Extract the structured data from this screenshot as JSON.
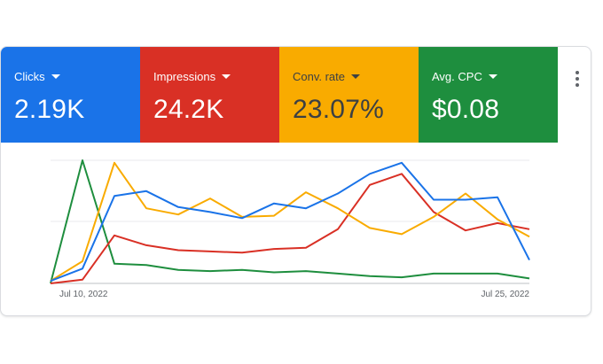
{
  "metrics": [
    {
      "label": "Clicks",
      "value": "2.19K",
      "color": "#1a73e8"
    },
    {
      "label": "Impressions",
      "value": "24.2K",
      "color": "#d93025"
    },
    {
      "label": "Conv. rate",
      "value": "23.07%",
      "color": "#f9ab00"
    },
    {
      "label": "Avg. CPC",
      "value": "$0.08",
      "color": "#1e8e3e"
    }
  ],
  "more_icon": "more-vert-icon",
  "chart_data": {
    "type": "line",
    "x_tick_labels": [
      "Jul 10, 2022",
      "Jul 25, 2022"
    ],
    "x": [
      "Jul 10",
      "Jul 11",
      "Jul 12",
      "Jul 13",
      "Jul 14",
      "Jul 15",
      "Jul 16",
      "Jul 17",
      "Jul 18",
      "Jul 19",
      "Jul 20",
      "Jul 21",
      "Jul 22",
      "Jul 23",
      "Jul 24",
      "Jul 25"
    ],
    "grid": true,
    "ylim": [
      0,
      100
    ],
    "series": [
      {
        "metric": "Clicks",
        "color": "#1a73e8",
        "values": [
          2,
          12,
          71,
          75,
          62,
          58,
          53,
          65,
          61,
          73,
          89,
          98,
          68,
          68,
          70,
          19
        ]
      },
      {
        "metric": "Impressions",
        "color": "#d93025",
        "values": [
          0,
          3,
          39,
          31,
          27,
          26,
          25,
          28,
          29,
          44,
          80,
          89,
          58,
          43,
          49,
          44
        ]
      },
      {
        "metric": "Conv. rate",
        "color": "#f9ab00",
        "values": [
          2,
          18,
          98,
          61,
          56,
          69,
          54,
          55,
          74,
          61,
          45,
          40,
          54,
          73,
          52,
          38
        ]
      },
      {
        "metric": "Avg. CPC",
        "color": "#1e8e3e",
        "values": [
          0,
          100,
          16,
          15,
          11,
          10,
          11,
          9,
          10,
          8,
          6,
          5,
          8,
          8,
          8,
          4
        ]
      }
    ]
  }
}
